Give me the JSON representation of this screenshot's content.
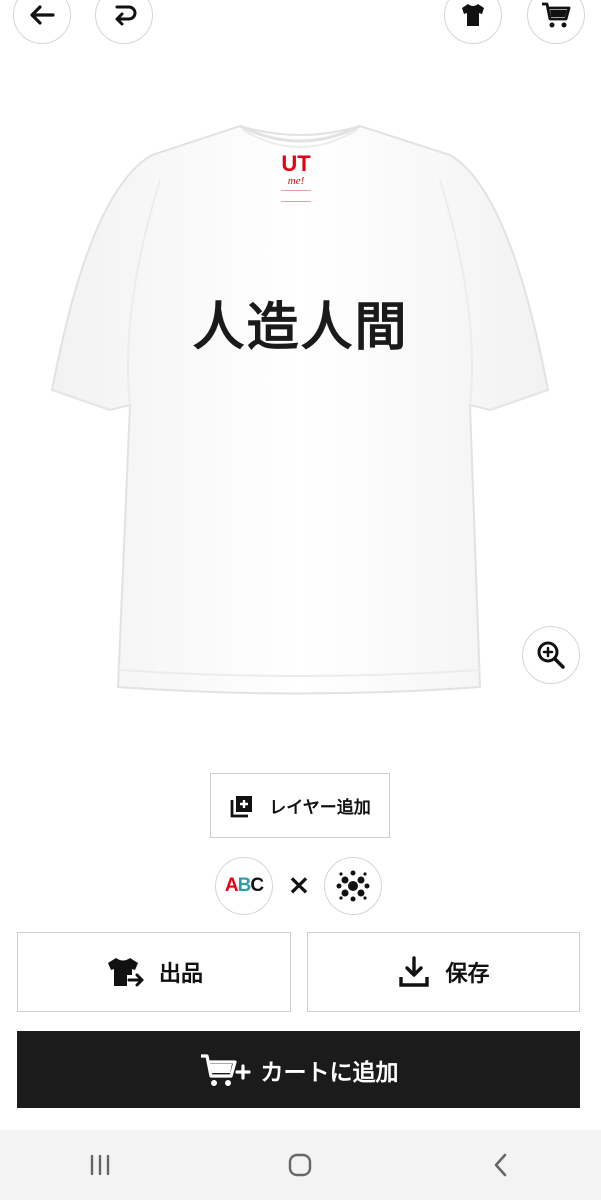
{
  "design": {
    "text": "人造人間",
    "tag_brand": "UT",
    "tag_sub": "me!"
  },
  "actions": {
    "add_layer": "レイヤー追加",
    "abc_label": "ABC",
    "times": "×",
    "publish": "出品",
    "save": "保存",
    "add_to_cart": "カートに追加"
  },
  "icons": {
    "back": "arrow-left-icon",
    "undo": "undo-icon",
    "shirt": "tshirt-icon",
    "cart": "cart-icon",
    "zoom": "zoom-in-icon",
    "pattern": "dots-pattern-icon"
  },
  "colors": {
    "brand_red": "#e60012",
    "dark": "#1b1b1b",
    "border": "#cfcfcf"
  }
}
